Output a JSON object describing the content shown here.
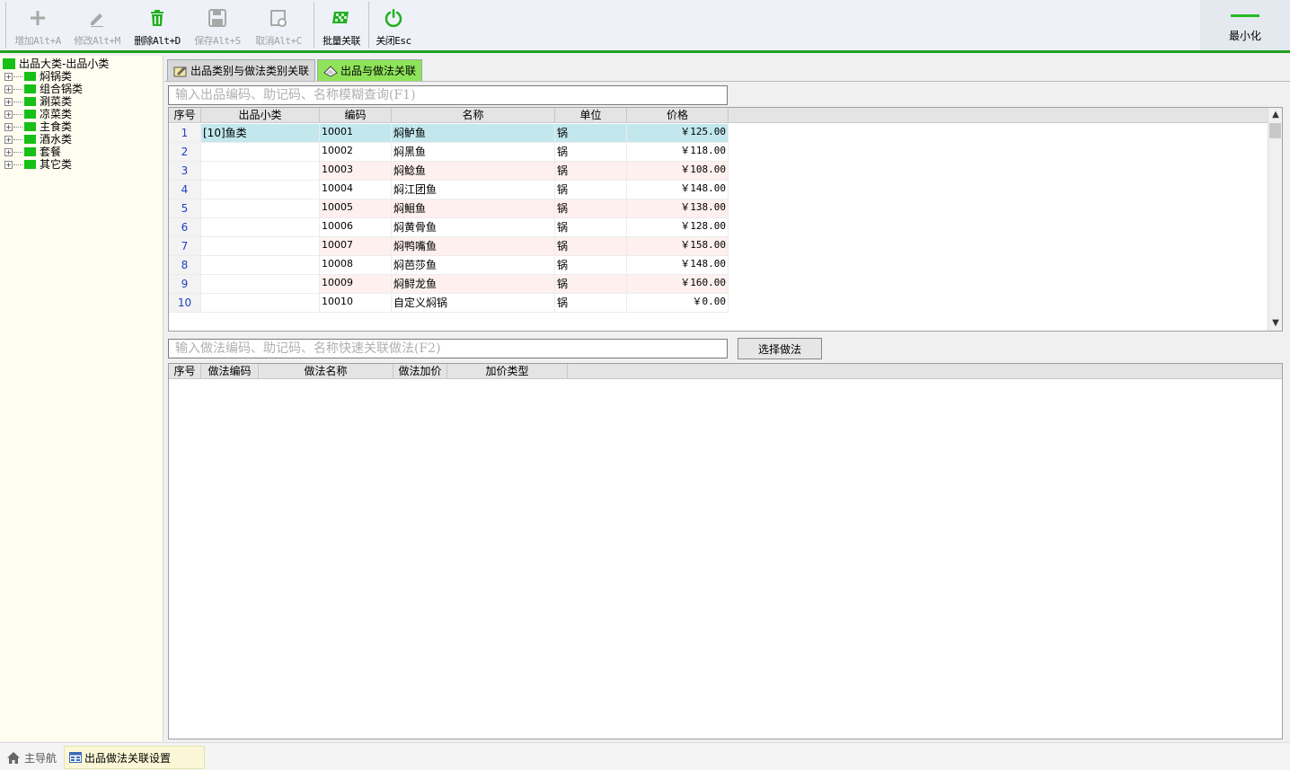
{
  "toolbar": {
    "add_label": "增加Alt+A",
    "edit_label": "修改Alt+M",
    "delete_label": "删除Alt+D",
    "save_label": "保存Alt+S",
    "cancel_label": "取消Alt+C",
    "batch_label": "批量关联",
    "close_label": "关闭Esc",
    "minimize_label": "最小化",
    "accent_color": "#1fa01f"
  },
  "tree": {
    "root": "出品大类-出品小类",
    "items": [
      "焖锅类",
      "组合锅类",
      "涮菜类",
      "凉菜类",
      "主食类",
      "酒水类",
      "套餐",
      "其它类"
    ]
  },
  "tabs": [
    {
      "label": "出品类别与做法类别关联"
    },
    {
      "label": "出品与做法关联"
    }
  ],
  "product_search": {
    "placeholder": "输入出品编码、助记码、名称模糊查询(F1)"
  },
  "method_search": {
    "placeholder": "输入做法编码、助记码、名称快速关联做法(F2)"
  },
  "select_method_button": "选择做法",
  "products_grid": {
    "columns": [
      "序号",
      "出品小类",
      "编码",
      "名称",
      "单位",
      "价格"
    ],
    "rows": [
      {
        "seq": "1",
        "sub": "[10]鱼类",
        "code": "10001",
        "name": "焖鲈鱼",
        "unit": "锅",
        "price": "￥125.00"
      },
      {
        "seq": "2",
        "sub": "",
        "code": "10002",
        "name": "焖黑鱼",
        "unit": "锅",
        "price": "￥118.00"
      },
      {
        "seq": "3",
        "sub": "",
        "code": "10003",
        "name": "焖鲶鱼",
        "unit": "锅",
        "price": "￥108.00"
      },
      {
        "seq": "4",
        "sub": "",
        "code": "10004",
        "name": "焖江团鱼",
        "unit": "锅",
        "price": "￥148.00"
      },
      {
        "seq": "5",
        "sub": "",
        "code": "10005",
        "name": "焖鮰鱼",
        "unit": "锅",
        "price": "￥138.00"
      },
      {
        "seq": "6",
        "sub": "",
        "code": "10006",
        "name": "焖黄骨鱼",
        "unit": "锅",
        "price": "￥128.00"
      },
      {
        "seq": "7",
        "sub": "",
        "code": "10007",
        "name": "焖鸭嘴鱼",
        "unit": "锅",
        "price": "￥158.00"
      },
      {
        "seq": "8",
        "sub": "",
        "code": "10008",
        "name": "焖芭莎鱼",
        "unit": "锅",
        "price": "￥148.00"
      },
      {
        "seq": "9",
        "sub": "",
        "code": "10009",
        "name": "焖鲟龙鱼",
        "unit": "锅",
        "price": "￥160.00"
      },
      {
        "seq": "10",
        "sub": "",
        "code": "10010",
        "name": "自定义焖锅",
        "unit": "锅",
        "price": "￥0.00"
      }
    ]
  },
  "methods_grid": {
    "columns": [
      "序号",
      "做法编码",
      "做法名称",
      "做法加价",
      "加价类型"
    ]
  },
  "bottom_nav": {
    "home": "主导航",
    "current": "出品做法关联设置"
  }
}
